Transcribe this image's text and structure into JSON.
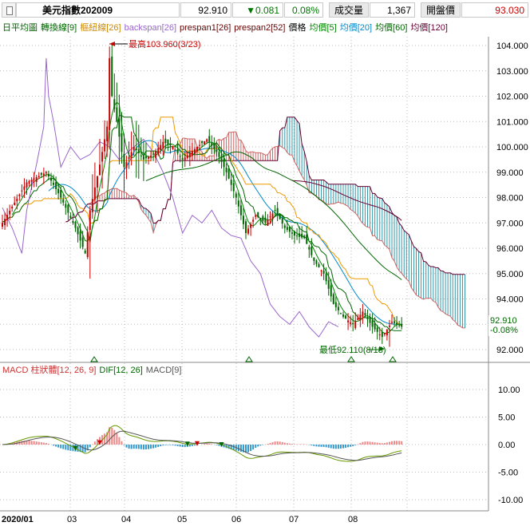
{
  "header": {
    "symbol_name": "美元指數202009",
    "last_price": "92.910",
    "change_arrow": "▼",
    "change": "0.081",
    "change_pct": "0.08%",
    "volume_label": "成交量",
    "volume": "1,367",
    "open_label": "開盤價",
    "open": "93.030"
  },
  "price_panel": {
    "legend": [
      {
        "text": "日平均圖",
        "color": "#006600"
      },
      {
        "text": "轉換線[9]",
        "color": "#006600"
      },
      {
        "text": "樞紐線[26]",
        "color": "#cc8800"
      },
      {
        "text": "backspan[26]",
        "color": "#9966cc"
      },
      {
        "text": "prespan1[26]",
        "color": "#660000"
      },
      {
        "text": "prespan2[52]",
        "color": "#660000"
      },
      {
        "text": "價格",
        "color": "#000000"
      },
      {
        "text": "均價[5]",
        "color": "#008800"
      },
      {
        "text": "均價[20]",
        "color": "#0088cc"
      },
      {
        "text": "均價[60]",
        "color": "#006600"
      },
      {
        "text": "均價[120]",
        "color": "#660033"
      }
    ],
    "high_annotation": "最高103.960(3/23)",
    "low_annotation": "最低92.110(8/18)",
    "y_ticks": [
      "104.000",
      "103.000",
      "102.000",
      "101.000",
      "100.000",
      "99.000",
      "98.000",
      "97.000",
      "96.000",
      "95.000",
      "94.000",
      "93.000",
      "92.000"
    ],
    "last_price_tag": "92.910",
    "last_change_tag": "-0.08%"
  },
  "macd_panel": {
    "legend": [
      {
        "text": "MACD 柱狀體[12, 26, 9]",
        "color": "#cc3333"
      },
      {
        "text": "DIF[12, 26]",
        "color": "#006600"
      },
      {
        "text": "MACD[9]",
        "color": "#555555"
      }
    ],
    "y_ticks": [
      "10.00",
      "5.00",
      "0.00",
      "-5.00",
      "-10.00"
    ]
  },
  "x_axis": {
    "labels": [
      "2020/01",
      "03",
      "04",
      "05",
      "06",
      "07",
      "08"
    ]
  },
  "colors": {
    "up_candle": "#cc0000",
    "down_candle": "#006600",
    "cloud_bull": "#cc6666",
    "cloud_bear": "#3399aa",
    "tenkan": "#006600",
    "kijun": "#ee9900",
    "chikou": "#9966cc",
    "ma5": "#008800",
    "ma20": "#0088cc",
    "ma60": "#006600",
    "ma120": "#660033",
    "grid": "#bbbbbb",
    "hist_pos": "#ee8888",
    "hist_neg": "#3399cc",
    "dif": "#669900",
    "macd": "#555555"
  }
}
